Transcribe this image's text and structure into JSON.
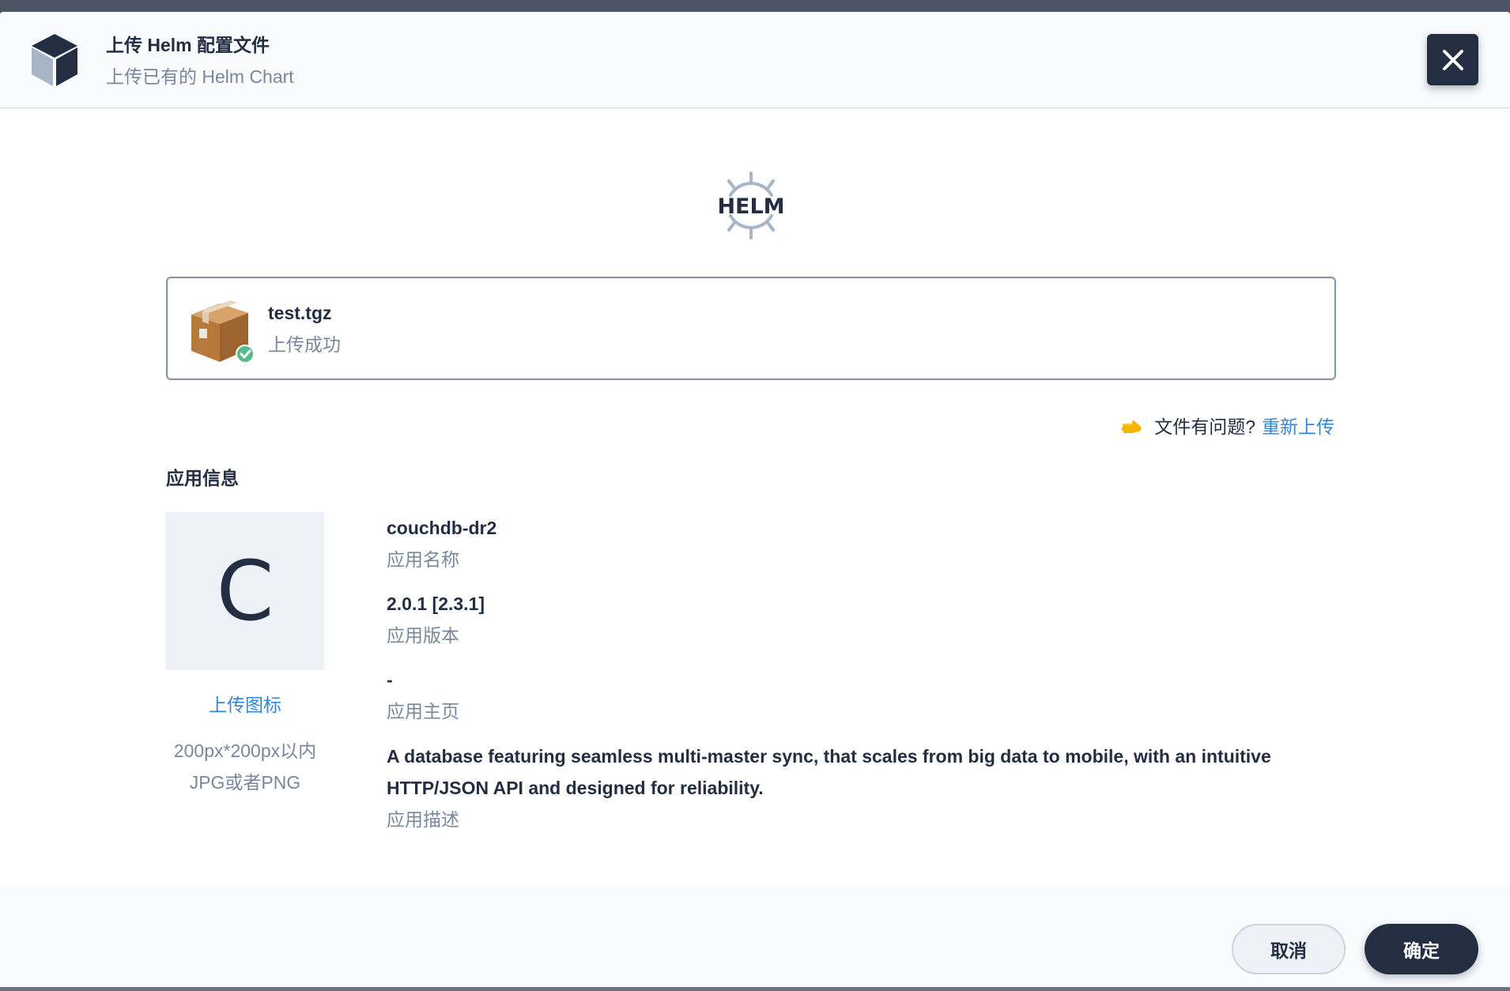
{
  "header": {
    "title": "上传 Helm 配置文件",
    "subtitle": "上传已有的 Helm Chart",
    "icon": "cube-icon"
  },
  "helm_logo": {
    "text": "HELM"
  },
  "file": {
    "name": "test.tgz",
    "status": "上传成功",
    "icon": "package-box-icon"
  },
  "reupload": {
    "question": "文件有问题?",
    "link": "重新上传"
  },
  "app_info": {
    "section_title": "应用信息",
    "avatar_letter": "C",
    "upload_icon_label": "上传图标",
    "icon_hint_line1": "200px*200px以内",
    "icon_hint_line2": "JPG或者PNG",
    "name_value": "couchdb-dr2",
    "name_label": "应用名称",
    "version_value": "2.0.1 [2.3.1]",
    "version_label": "应用版本",
    "home_value": "-",
    "home_label": "应用主页",
    "description_value": "A database featuring seamless multi-master sync, that scales from big data to mobile, with an intuitive HTTP/JSON API and designed for reliability.",
    "description_label": "应用描述"
  },
  "footer": {
    "cancel_label": "取消",
    "ok_label": "确定"
  },
  "colors": {
    "primary_dark": "#242e42",
    "link_blue": "#3385d6",
    "muted_text": "#79879c",
    "success_green": "#55bc8a"
  }
}
